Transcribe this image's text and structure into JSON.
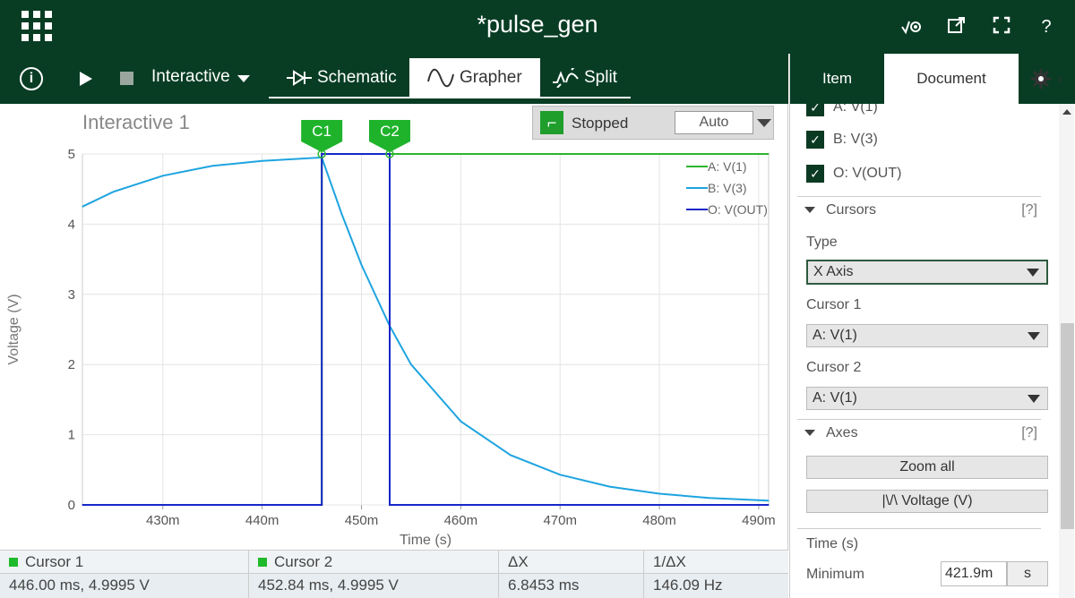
{
  "app": {
    "title": "*pulse_gen",
    "top_icons": [
      "probe-icon",
      "external-link-icon",
      "fullscreen-icon",
      "help-icon"
    ],
    "help_label": "?"
  },
  "toolbar": {
    "mode": "Interactive",
    "tabs": [
      {
        "label": "Schematic",
        "icon": "diode-icon"
      },
      {
        "label": "Grapher",
        "icon": "sine-wave-icon",
        "active": true
      },
      {
        "label": "Split",
        "icon": "split-icon"
      }
    ]
  },
  "graph": {
    "title": "Interactive 1",
    "sim_status": "Stopped",
    "scale_mode": "Auto",
    "cursor_flags": [
      "C1",
      "C2"
    ]
  },
  "chart_data": {
    "type": "line",
    "xlabel": "Time (s)",
    "ylabel": "Voltage (V)",
    "xlim": [
      421.9,
      491
    ],
    "ylim": [
      0,
      5
    ],
    "x_ticks": [
      "430m",
      "440m",
      "450m",
      "460m",
      "470m",
      "480m",
      "490m"
    ],
    "x_tick_values": [
      430,
      440,
      450,
      460,
      470,
      480,
      490
    ],
    "y_ticks": [
      0,
      1,
      2,
      3,
      4,
      5
    ],
    "grid": true,
    "legend_position": "top-right",
    "cursors": [
      {
        "name": "C1",
        "x": 446.0
      },
      {
        "name": "C2",
        "x": 452.84
      }
    ],
    "series": [
      {
        "name": "A: V(1)",
        "color": "#2db52d",
        "points": [
          [
            421.9,
            0
          ],
          [
            446.0,
            0
          ],
          [
            446.0,
            4.9995
          ],
          [
            491,
            4.9995
          ]
        ]
      },
      {
        "name": "B: V(3)",
        "color": "#1ea4e0",
        "points": [
          [
            421.9,
            4.25
          ],
          [
            425,
            4.46
          ],
          [
            430,
            4.69
          ],
          [
            435,
            4.83
          ],
          [
            440,
            4.9
          ],
          [
            446.0,
            4.95
          ],
          [
            448,
            4.15
          ],
          [
            450,
            3.42
          ],
          [
            452.84,
            2.55
          ],
          [
            455,
            2.0
          ],
          [
            460,
            1.19
          ],
          [
            465,
            0.71
          ],
          [
            470,
            0.43
          ],
          [
            475,
            0.26
          ],
          [
            480,
            0.16
          ],
          [
            485,
            0.1
          ],
          [
            491,
            0.06
          ]
        ]
      },
      {
        "name": "O: V(OUT)",
        "color": "#1727c8",
        "points": [
          [
            421.9,
            0
          ],
          [
            446.0,
            0
          ],
          [
            446.0,
            4.9995
          ],
          [
            452.84,
            4.9995
          ],
          [
            452.84,
            0
          ],
          [
            491,
            0
          ]
        ]
      }
    ]
  },
  "readout": {
    "headers": [
      "Cursor 1",
      "Cursor 2",
      "ΔX",
      "1/ΔX"
    ],
    "values": [
      "446.00 ms, 4.9995 V",
      "452.84 ms, 4.9995 V",
      "6.8453 ms",
      "146.09 Hz"
    ]
  },
  "panel": {
    "tabs": [
      "Item",
      "Document"
    ],
    "traces": [
      "A: V(1)",
      "B: V(3)",
      "O: V(OUT)"
    ],
    "cursors_section": "Cursors",
    "help": "[?]",
    "type_label": "Type",
    "type_value": "X Axis",
    "cursor1_label": "Cursor 1",
    "cursor1_value": "A: V(1)",
    "cursor2_label": "Cursor 2",
    "cursor2_value": "A: V(1)",
    "axes_section": "Axes",
    "zoom_all": "Zoom all",
    "voltage_axis": "|\\/\\  Voltage (V)",
    "time_label": "Time (s)",
    "minimum_label": "Minimum",
    "minimum_value": "421.9m",
    "minimum_unit": "s"
  }
}
